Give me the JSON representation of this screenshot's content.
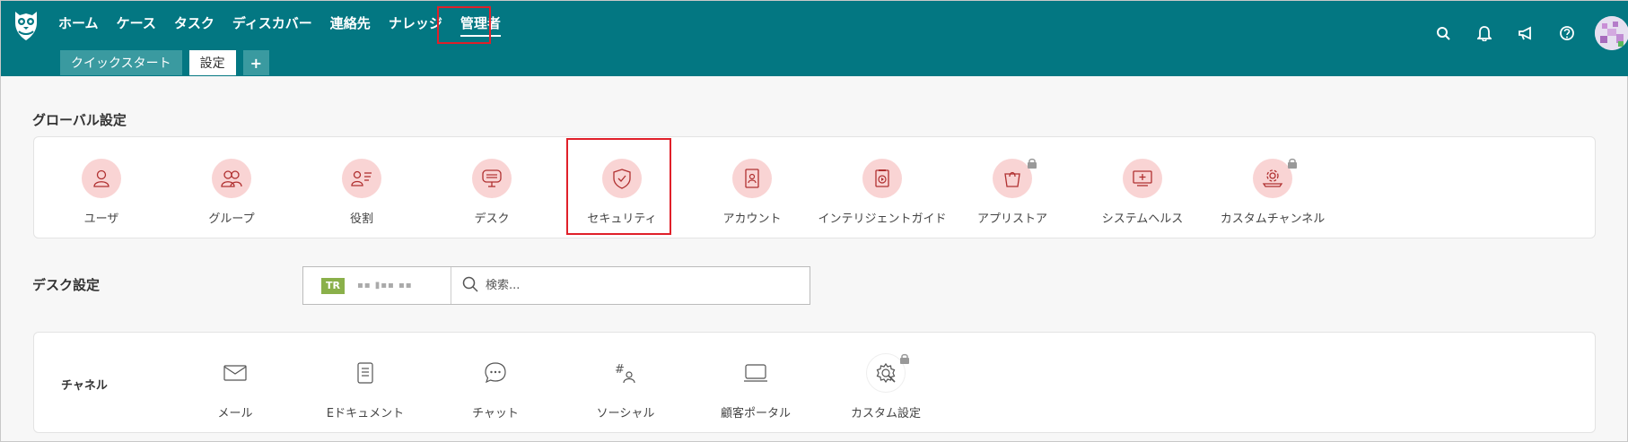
{
  "nav": {
    "items": [
      {
        "label": "ホーム"
      },
      {
        "label": "ケース"
      },
      {
        "label": "タスク"
      },
      {
        "label": "ディスカバー"
      },
      {
        "label": "連絡先"
      },
      {
        "label": "ナレッジ"
      },
      {
        "label": "管理者"
      }
    ],
    "active_index": 6
  },
  "tabs": [
    {
      "label": "クイックスタート"
    },
    {
      "label": "設定"
    },
    {
      "label": "+"
    }
  ],
  "top_icons": [
    "search-icon",
    "bell-icon",
    "megaphone-icon",
    "help-icon",
    "avatar"
  ],
  "global_settings": {
    "title": "グローバル設定",
    "items": [
      {
        "label": "ユーザ",
        "icon": "user-icon"
      },
      {
        "label": "グループ",
        "icon": "group-icon"
      },
      {
        "label": "役割",
        "icon": "role-icon"
      },
      {
        "label": "デスク",
        "icon": "desk-icon"
      },
      {
        "label": "セキュリティ",
        "icon": "shield-icon"
      },
      {
        "label": "アカウント",
        "icon": "account-icon"
      },
      {
        "label": "インテリジェントガイド",
        "icon": "guide-icon"
      },
      {
        "label": "アプリストア",
        "icon": "store-icon"
      },
      {
        "label": "システムヘルス",
        "icon": "system-health-icon"
      },
      {
        "label": "カスタムチャンネル",
        "icon": "custom-channel-icon"
      }
    ]
  },
  "desk_settings": {
    "title": "デスク設定",
    "desk_badge": "TR",
    "search_placeholder": "検索..."
  },
  "channels": {
    "title": "チャネル",
    "items": [
      {
        "label": "メール",
        "icon": "mail-icon"
      },
      {
        "label": "Eドキュメント",
        "icon": "document-icon"
      },
      {
        "label": "チャット",
        "icon": "chat-icon"
      },
      {
        "label": "ソーシャル",
        "icon": "social-icon"
      },
      {
        "label": "顧客ポータル",
        "icon": "portal-icon"
      },
      {
        "label": "カスタム設定",
        "icon": "custom-settings-icon"
      }
    ]
  },
  "colors": {
    "topbar": "#037782",
    "highlight": "#e0202a",
    "icon_bg": "#f9d4d4",
    "icon_stroke": "#c0392b"
  }
}
